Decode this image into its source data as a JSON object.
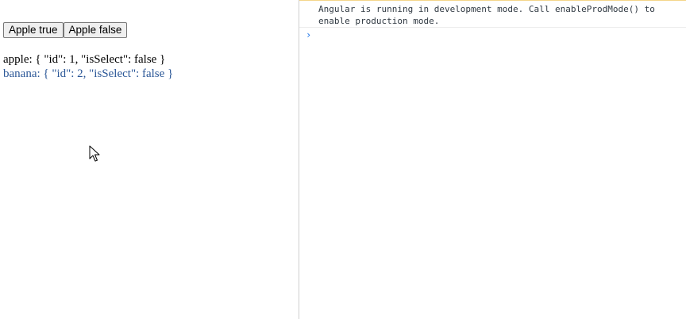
{
  "preview": {
    "buttons": [
      {
        "label": "Apple true"
      },
      {
        "label": "Apple false"
      }
    ],
    "lines": {
      "apple": "apple: { \"id\": 1, \"isSelect\": false }",
      "banana": "banana: { \"id\": 2, \"isSelect\": false }"
    }
  },
  "console": {
    "message": "Angular is running in development mode. Call enableProdMode() to enable production mode.",
    "prompt_symbol": "›"
  },
  "colors": {
    "banana_text": "#2b5797",
    "prompt": "#1a73e8",
    "console_text": "#303942"
  },
  "icons": {
    "cursor": "mouse-pointer-icon",
    "prompt": "chevron-right-icon"
  }
}
